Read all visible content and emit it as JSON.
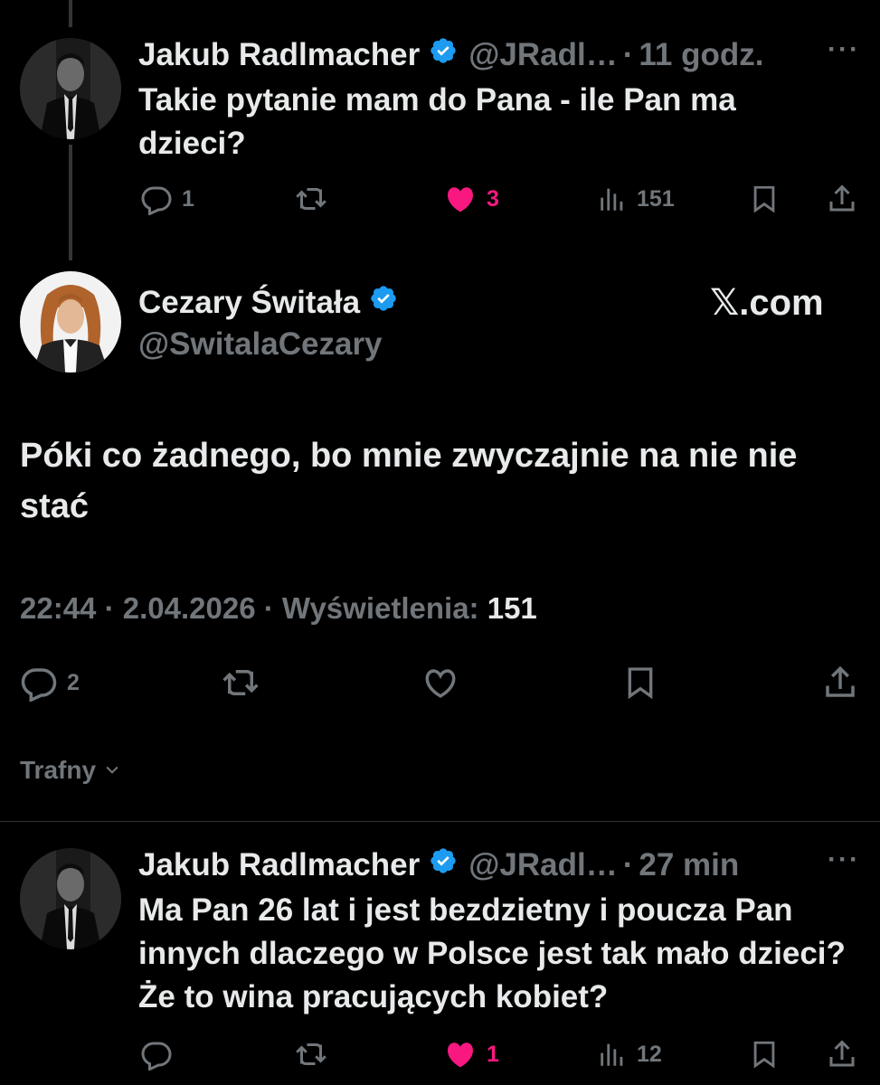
{
  "tweet1": {
    "name": "Jakub Radlmacher",
    "handle": "@JRadl…",
    "separator": "·",
    "time": "11 godz.",
    "text": "Takie pytanie mam do Pana - ile Pan ma dzieci?",
    "replies": "1",
    "likes": "3",
    "views": "151",
    "more_icon": "more-dots-icon"
  },
  "main_tweet": {
    "name": "Cezary Świtała",
    "handle": "@SwitalaCezary",
    "watermark": "𝕏.com",
    "text": "Póki co żadnego, bo mnie zwyczajnie na nie nie stać",
    "time": "22:44",
    "sep1": "·",
    "date": "2.04.2026",
    "sep2": "·",
    "views_label": "Wyświetlenia:",
    "views": "151",
    "replies": "2"
  },
  "sort": {
    "label": "Trafny"
  },
  "tweet2": {
    "name": "Jakub Radlmacher",
    "handle": "@JRadl…",
    "separator": "·",
    "time": "27 min",
    "text": "Ma Pan 26 lat i jest bezdzietny i poucza Pan innych dlaczego w Polsce jest tak mało dzieci? Że to wina pracujących kobiet?",
    "likes": "1",
    "views": "12"
  },
  "colors": {
    "background": "#000000",
    "text": "#e7e9ea",
    "muted": "#71767b",
    "verified": "#1d9bf0",
    "like": "#f91880"
  }
}
